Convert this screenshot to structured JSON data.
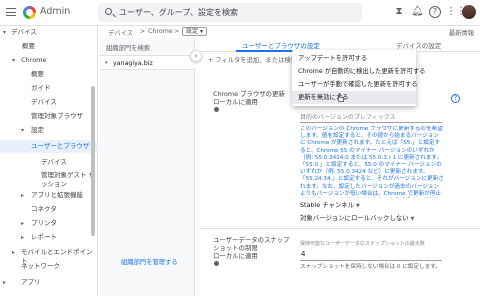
{
  "topbar": {
    "app_title": "Admin",
    "search_text": "ユーザー、グループ、設定を検索",
    "icons": [
      "menu-icon",
      "search-icon",
      "hourglass-icon",
      "bell-icon",
      "help-icon",
      "apps-icon",
      "avatar"
    ]
  },
  "breadcrumb": {
    "part1": "デバイス",
    "sep1": ">",
    "part2": "Chrome",
    "sep2": ">",
    "current": "設定",
    "latest": "最新情報"
  },
  "leftnav": {
    "items": [
      {
        "icon": "▾",
        "label": "デバイス"
      },
      {
        "icon": "",
        "label": "概要"
      },
      {
        "icon": "▾",
        "label": "Chrome"
      },
      {
        "icon": "",
        "label": "概要"
      },
      {
        "icon": "",
        "label": "ガイド"
      },
      {
        "icon": "",
        "label": "デバイス"
      },
      {
        "icon": "",
        "label": "管理対象ブラウザ"
      },
      {
        "icon": "▾",
        "label": "設定"
      },
      {
        "icon": "",
        "label": "ユーザーとブラウザ"
      },
      {
        "icon": "",
        "label": "デバイス"
      },
      {
        "icon": "",
        "label": "管理対象ゲスト セッション"
      },
      {
        "icon": "▸",
        "label": "アプリと拡張機能"
      },
      {
        "icon": "",
        "label": "コネクタ"
      },
      {
        "icon": "▸",
        "label": "プリンタ"
      },
      {
        "icon": "▸",
        "label": "レポート"
      },
      {
        "icon": "▸",
        "label": "モバイルとエンドポイント"
      },
      {
        "icon": "",
        "label": "ネットワーク"
      },
      {
        "icon": "▸",
        "label": "アプリ"
      }
    ]
  },
  "orgpanel": {
    "header": "組織部門を検索",
    "org_name": "yanagiya.biz",
    "manage_link": "組織部門を管理する"
  },
  "tabs": {
    "active": "ユーザーとブラウザの設定",
    "other": "デバイスの設定"
  },
  "filter": {
    "placeholder": "フィルタを追加、または検索"
  },
  "dropdown": {
    "items": [
      "アップデートを許可する",
      "Chrome が自動的に検出した更新を許可する",
      "ユーザーが手動で確認した更新を許可する",
      "更新を無効にする"
    ],
    "hover_index": 3
  },
  "setting_update": {
    "label_line1": "Chrome ブラウザの更新",
    "label_line2": "ローカルに適用",
    "prefix_label": "目的のバージョンのプレフィックス",
    "hint": "このバージョンの Chrome ブラウザに更新するのを希望します。値を設定すると、その値から始まるバージョンに Chrome が更新されます。たとえば「55.」と設定すると、Chrome 55 のマイナー バージョンのいずれか（例: 55.0.3424.0 または 55.0.3.) 1 に更新されます。「55.0.」と設定すると、55.0 のマイナー バージョンのいずれか（例: 55.0.3424 など）に更新されます。「55.24.34.」と設定すると、それがバージョンに更新されます。なお、設定したバージョンが過去のバージョンよりもバージョンが低い場合は、Chrome で更新が停止されたり、ロールバックされなかったりすることがあります。",
    "channel": "Stable チャンネル",
    "rollback": "対象バージョンにロールバックしない"
  },
  "setting_snapshot": {
    "label_line1": "ユーザーデータのスナップ",
    "label_line2": "ショットの制限",
    "label_line3": "ローカルに適用",
    "field_label": "保持可能なユーザーデータのスナップショットの最大数",
    "value": "4",
    "hint": "スナップショットを保持しない場合は 0 に設定します。"
  }
}
